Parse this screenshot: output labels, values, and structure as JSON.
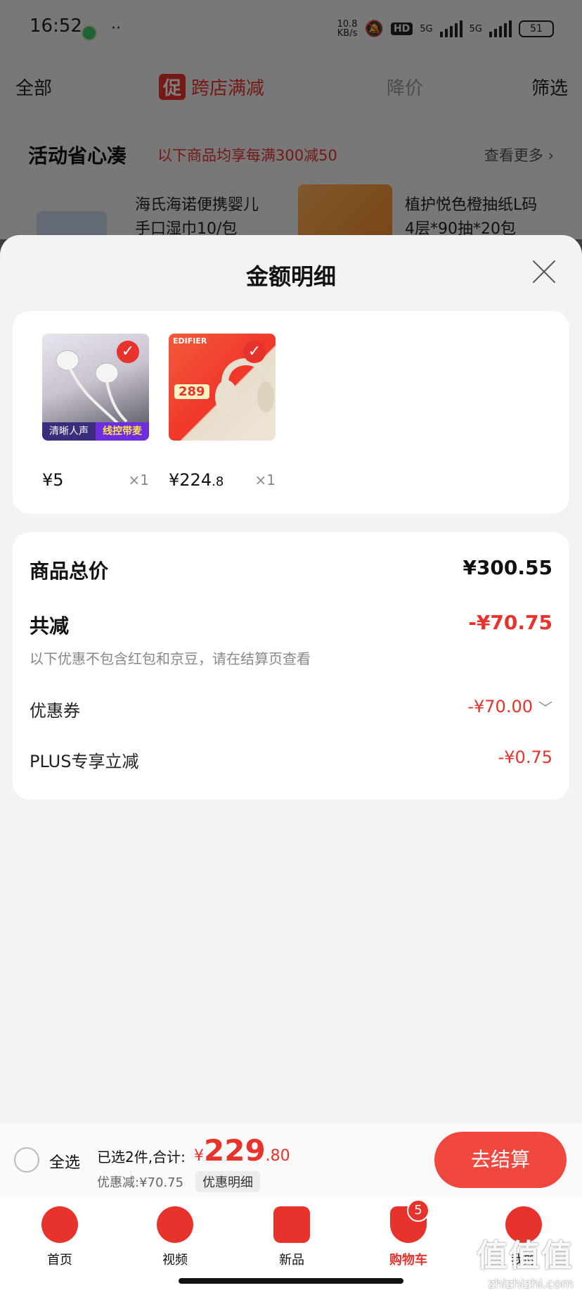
{
  "status_bar": {
    "time": "16:52",
    "net_speed_top": "10.8",
    "net_speed_unit": "KB/s",
    "sim1": "5G",
    "sim2": "5G",
    "battery": "51"
  },
  "background": {
    "tabs": [
      "全部",
      "跨店满减",
      "降价",
      "筛选"
    ],
    "promo_icon_text": "促",
    "activity_title": "活动省心凑",
    "activity_subtitle": "以下商品均享每满300减50",
    "see_more": "查看更多 ›",
    "items": [
      {
        "title_line1": "海氏海诺便携婴儿",
        "title_line2": "手口湿巾10/包"
      },
      {
        "title_line1": "植护悦色橙抽纸L码",
        "title_line2": "4层*90抽*20包"
      }
    ]
  },
  "sheet": {
    "title": "金额明细",
    "products": [
      {
        "image_caption_left": "清晰人声",
        "image_caption_right": "线控带麦",
        "price_symbol": "¥",
        "price_int": "5",
        "price_dec": "",
        "qty": "×1"
      },
      {
        "image_brand": "EDIFIER",
        "image_caption": "289",
        "price_symbol": "¥",
        "price_int": "224",
        "price_dec": ".8",
        "qty": "×1"
      }
    ],
    "summary": {
      "total_label": "商品总价",
      "total_value": "¥300.55",
      "discount_label": "共减",
      "discount_value": "-¥70.75",
      "note": "以下优惠不包含红包和京豆，请在结算页查看",
      "coupon_label": "优惠券",
      "coupon_value": "-¥70.00",
      "plus_label": "PLUS专享立减",
      "plus_value": "-¥0.75"
    }
  },
  "checkout_bar": {
    "select_all": "全选",
    "selected_text": "已选2件,合计:",
    "total_symbol": "¥",
    "total_int": "229",
    "total_dec": ".80",
    "saved_text": "优惠减:¥70.75",
    "detail_button": "优惠明细",
    "checkout_button": "去结算"
  },
  "bottom_nav": {
    "items": [
      "首页",
      "视频",
      "新品",
      "购物车",
      "我的"
    ],
    "cart_badge": "5"
  },
  "watermark": {
    "text": "值值值",
    "url": "zhizhizhi.com"
  },
  "colors": {
    "accent": "#e8322c",
    "button": "#f0483e"
  }
}
